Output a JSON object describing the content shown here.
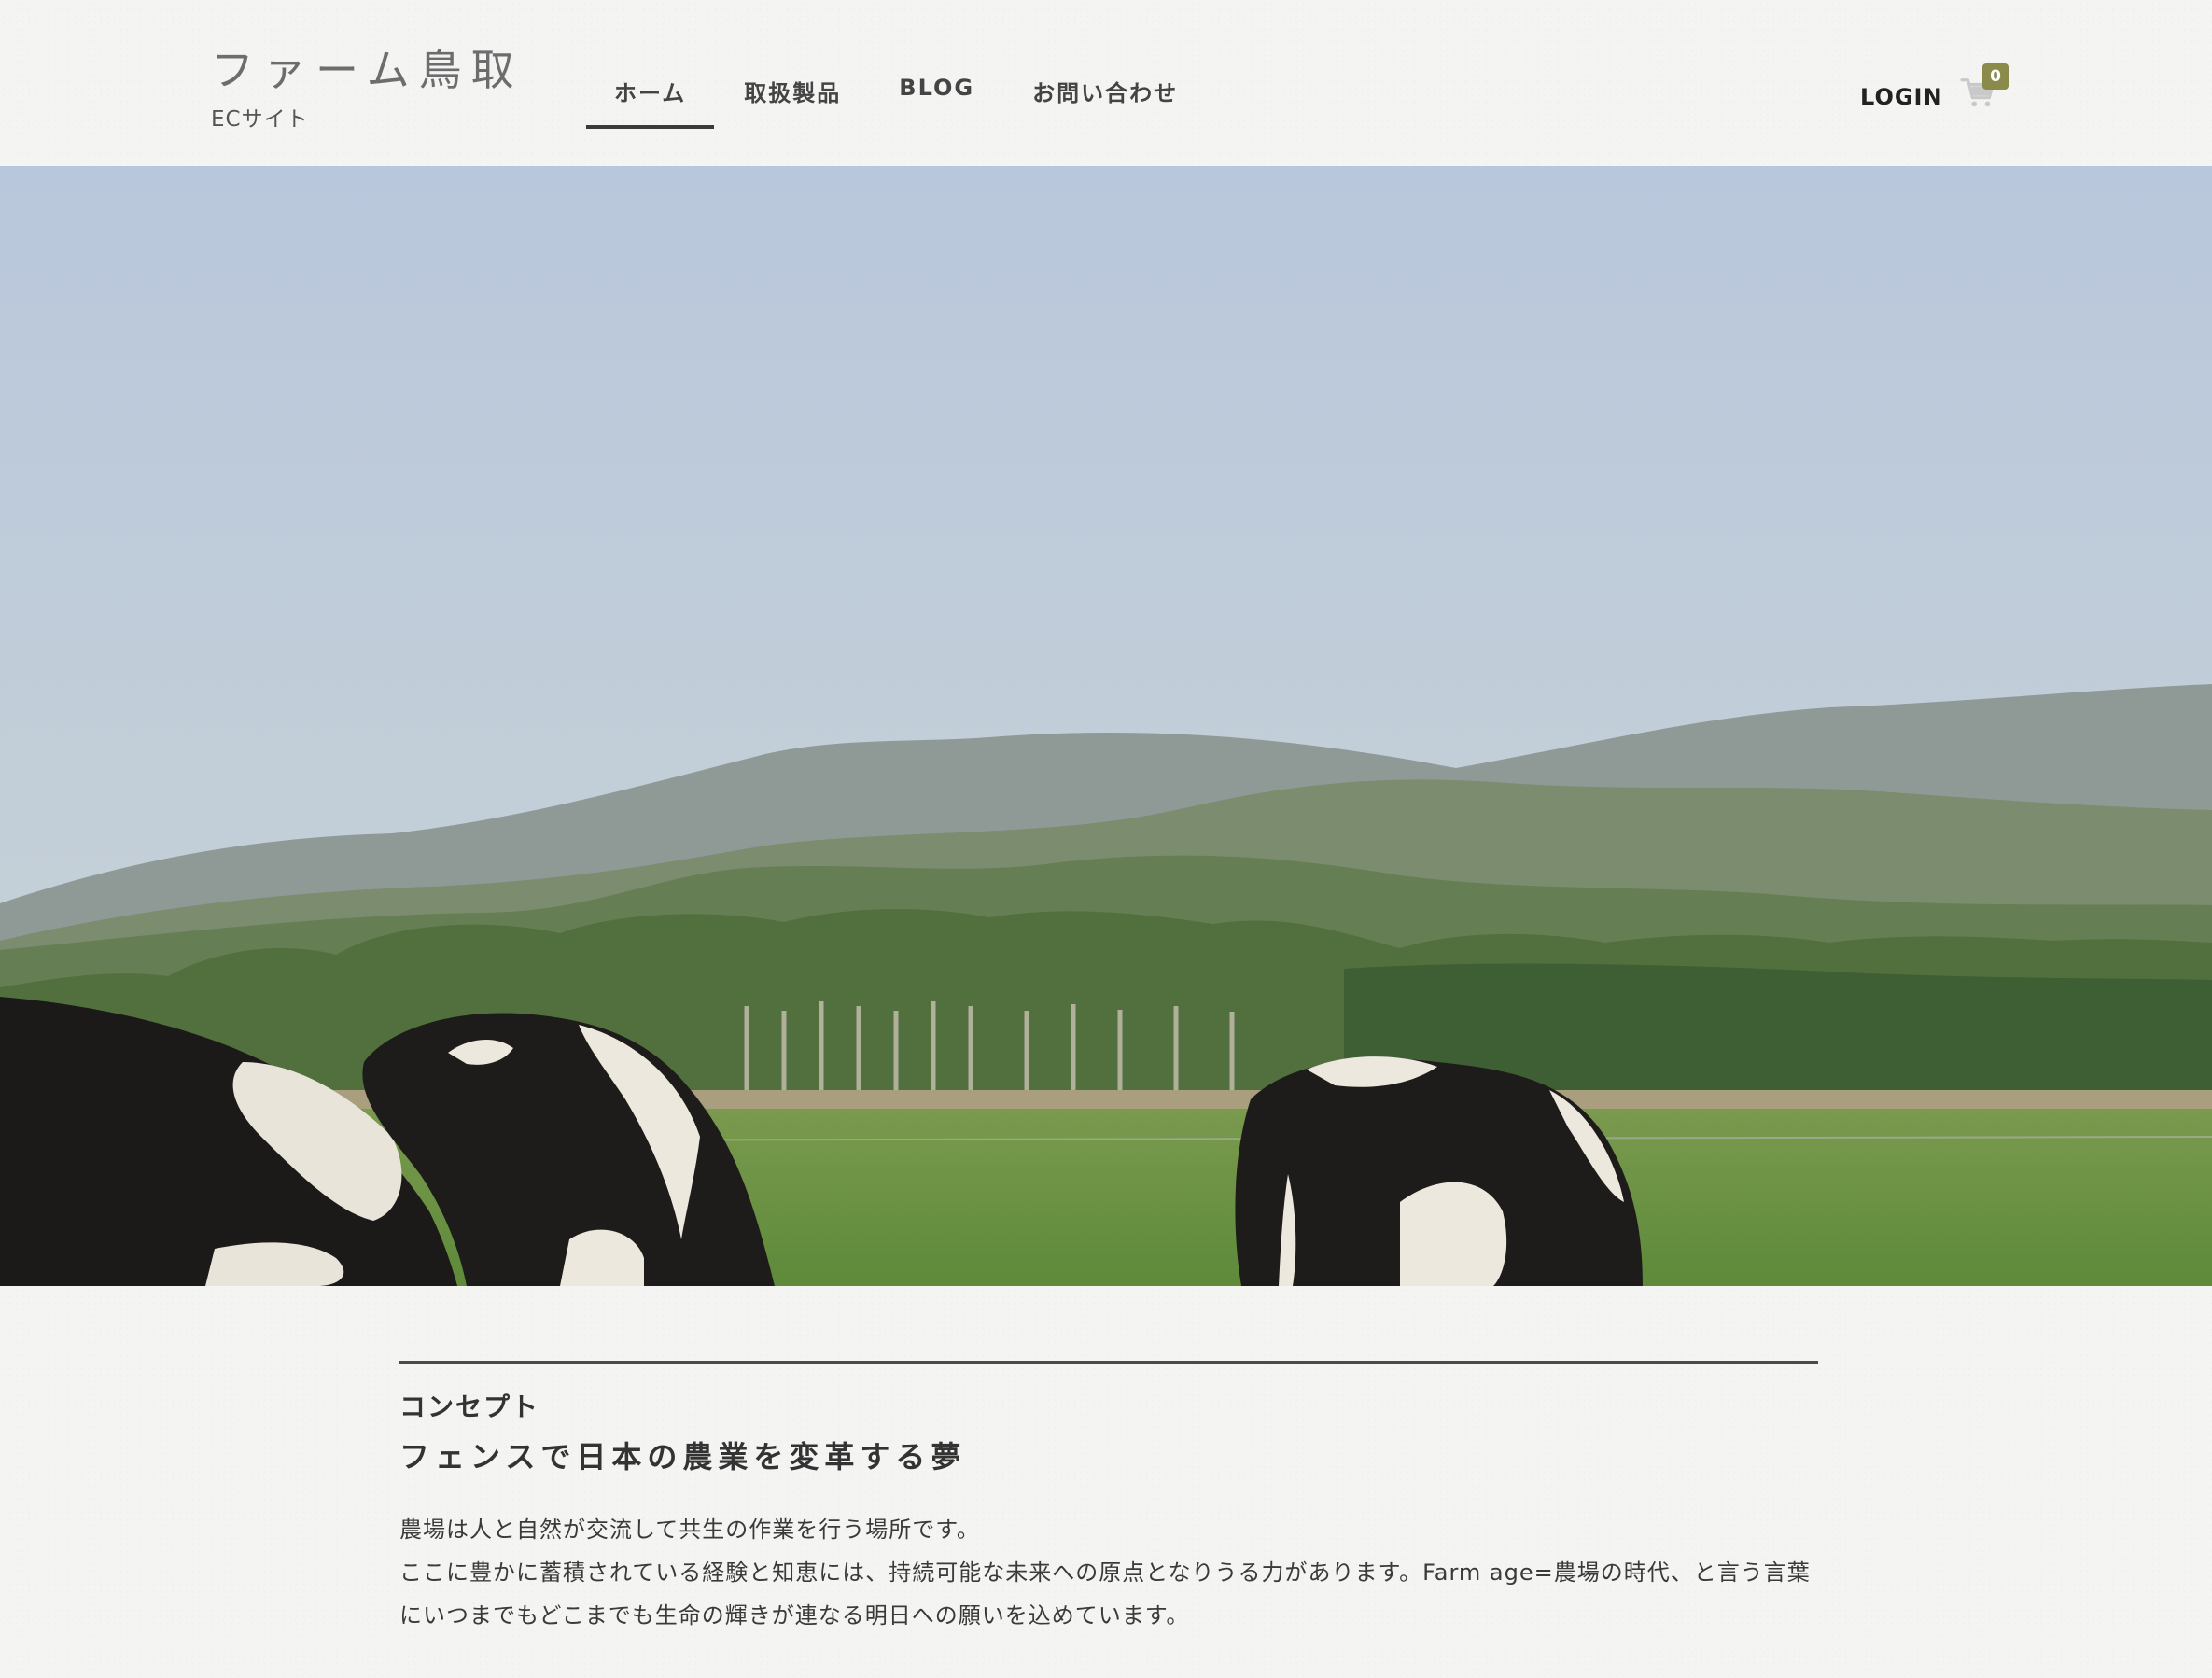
{
  "site": {
    "title": "ファーム鳥取",
    "subtitle": "ECサイト"
  },
  "nav": {
    "items": [
      {
        "label": "ホーム",
        "active": true
      },
      {
        "label": "取扱製品",
        "active": false
      },
      {
        "label": "BLOG",
        "active": false
      },
      {
        "label": "お問い合わせ",
        "active": false
      }
    ]
  },
  "header": {
    "login_label": "LOGIN",
    "cart_count": "0",
    "cart_icon": "cart-icon"
  },
  "hero": {
    "image": "pasture with grazing holstein cows, mountains and tree line"
  },
  "concept": {
    "label": "コンセプト",
    "heading": "フェンスで日本の農業を変革する夢",
    "paragraph_1": "農場は人と自然が交流して共生の作業を行う場所です。",
    "paragraph_2": "ここに豊かに蓄積されている経験と知恵には、持続可能な未来への原点となりうる力があります。Farm age=農場の時代、と言う言葉にいつまでもどこまでも生命の輝きが連なる明日への願いを込めています。"
  },
  "colors": {
    "background": "#f4f4f3",
    "badge": "#8a8a4a",
    "text": "#3a3a3a"
  }
}
